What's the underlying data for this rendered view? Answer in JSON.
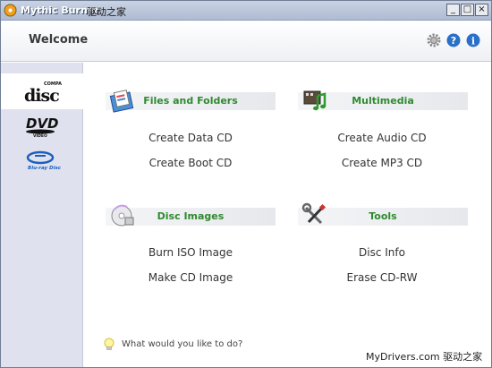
{
  "window": {
    "title": "Mythic Burner",
    "title_overlay": "驱动之家"
  },
  "header": {
    "title": "Welcome",
    "icons": [
      "gear-icon",
      "help-icon",
      "info-icon"
    ]
  },
  "sidebar": {
    "items": [
      {
        "name": "compact-disc",
        "label": "COMPACT disc"
      },
      {
        "name": "dvd",
        "label": "DVD VIDEO"
      },
      {
        "name": "blu-ray",
        "label": "Blu-ray Disc"
      }
    ]
  },
  "sections": {
    "files": {
      "title": "Files and Folders",
      "actions": [
        "Create Data CD",
        "Create Boot CD"
      ]
    },
    "multimedia": {
      "title": "Multimedia",
      "actions": [
        "Create Audio CD",
        "Create MP3 CD"
      ]
    },
    "images": {
      "title": "Disc Images",
      "actions": [
        "Burn ISO Image",
        "Make CD Image"
      ]
    },
    "tools": {
      "title": "Tools",
      "actions": [
        "Disc Info",
        "Erase CD-RW"
      ]
    }
  },
  "footer": {
    "tip": "What would you like to do?"
  },
  "watermark": {
    "text": "MyDrivers.com 驱动之家"
  },
  "colors": {
    "section_title": "#2f8a2f",
    "sidebar_bg": "#dfe2ee",
    "accent_blue": "#2a6fc8"
  }
}
